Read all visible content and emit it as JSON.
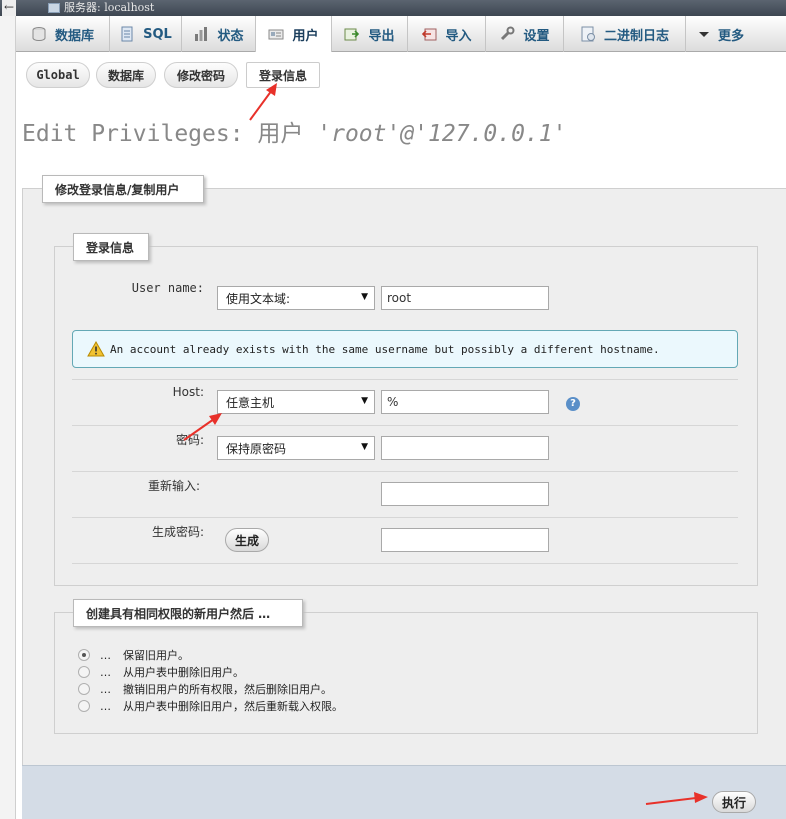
{
  "topbar": {
    "back": "←",
    "server_label": "服务器: localhost"
  },
  "tabs": [
    {
      "label": "数据库",
      "icon": "database-icon"
    },
    {
      "label": "SQL",
      "icon": "sql-icon"
    },
    {
      "label": "状态",
      "icon": "status-icon"
    },
    {
      "label": "用户",
      "icon": "users-icon"
    },
    {
      "label": "导出",
      "icon": "export-icon"
    },
    {
      "label": "导入",
      "icon": "import-icon"
    },
    {
      "label": "设置",
      "icon": "wrench-icon"
    },
    {
      "label": "二进制日志",
      "icon": "binlog-icon"
    },
    {
      "label": "更多",
      "icon": "chevron-down-icon"
    }
  ],
  "subtabs": [
    "Global",
    "数据库",
    "修改密码",
    "登录信息"
  ],
  "page_title": {
    "prefix": "Edit Privileges: 用户 ",
    "user": "'root'@'127.0.0.1'"
  },
  "main_legend": "修改登录信息/复制用户",
  "login_legend": "登录信息",
  "username": {
    "label": "User name:",
    "select": "使用文本域:",
    "value": "root"
  },
  "notice": "An account already exists with the same username but possibly a different hostname.",
  "host": {
    "label": "Host:",
    "select": "任意主机",
    "value": "%"
  },
  "password": {
    "label": "密码:",
    "select": "保持原密码",
    "value": ""
  },
  "retype": {
    "label": "重新输入:",
    "value": ""
  },
  "generate": {
    "label": "生成密码:",
    "button": "生成",
    "value": ""
  },
  "copy_legend": "创建具有相同权限的新用户然后 …",
  "options": [
    {
      "prefix": "…",
      "label": "保留旧用户。",
      "checked": true
    },
    {
      "prefix": "…",
      "label": "从用户表中删除旧用户。",
      "checked": false
    },
    {
      "prefix": "…",
      "label": "撤销旧用户的所有权限，然后删除旧用户。",
      "checked": false
    },
    {
      "prefix": "…",
      "label": "从用户表中删除旧用户，然后重新载入权限。",
      "checked": false
    }
  ],
  "submit": "执行",
  "colors": {
    "tab_text": "#235a81",
    "arrow": "#e8312a",
    "notice_bg": "#ebf8fd"
  }
}
